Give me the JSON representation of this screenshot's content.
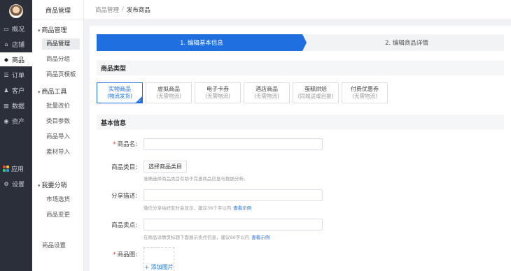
{
  "rail": {
    "items": [
      {
        "label": "概况",
        "icon": "overview-icon",
        "glyph": "▭"
      },
      {
        "label": "店铺",
        "icon": "store-icon",
        "glyph": "⌂"
      },
      {
        "label": "商品",
        "icon": "tag-icon",
        "glyph": "◆"
      },
      {
        "label": "订单",
        "icon": "order-icon",
        "glyph": "☰"
      },
      {
        "label": "客户",
        "icon": "customer-icon",
        "glyph": "♟"
      },
      {
        "label": "数据",
        "icon": "data-icon",
        "glyph": "▥"
      },
      {
        "label": "资产",
        "icon": "asset-icon",
        "glyph": "◉"
      },
      {
        "label": "应用",
        "icon": "apps-icon",
        "glyph": ""
      },
      {
        "label": "设置",
        "icon": "settings-icon",
        "glyph": "⚙"
      }
    ],
    "active_index": 2
  },
  "submenu": {
    "title": "商品管理",
    "groups": [
      {
        "label": "商品管理",
        "items": [
          "商品管理",
          "商品分组",
          "商品页模板"
        ]
      },
      {
        "label": "商品工具",
        "items": [
          "批量改价",
          "类目参数",
          "商品导入",
          "素材导入"
        ]
      },
      {
        "label": "我要分销",
        "items": [
          "市场选货",
          "商品变更"
        ]
      }
    ],
    "footer_item": "商品设置",
    "active_item": "商品管理"
  },
  "breadcrumb": {
    "parent": "商品管理",
    "separator": "/",
    "current": "发布商品"
  },
  "steps": {
    "step1": "1. 编辑基本信息",
    "step2": "2. 编辑商品详情"
  },
  "product_type": {
    "heading": "商品类型",
    "cards": [
      {
        "title": "实物商品",
        "sub": "(物流发货)",
        "selected": true
      },
      {
        "title": "虚拟商品",
        "sub": "(无需物流)",
        "selected": false
      },
      {
        "title": "电子卡券",
        "sub": "(无需物流)",
        "selected": false
      },
      {
        "title": "酒店商品",
        "sub": "(无需物流)",
        "selected": false
      },
      {
        "title": "蛋糕烘焙",
        "sub": "(同城送或自提)",
        "selected": false
      },
      {
        "title": "付费优惠券",
        "sub": "(无需物流)",
        "selected": false
      }
    ]
  },
  "basic_info": {
    "heading": "基本信息",
    "name_label": "商品名:",
    "category_label": "商品类目:",
    "category_button": "选择商品类目",
    "category_help": "准确选择商品类目有助于完善商品信息与数据分析。",
    "share_label": "分享描述:",
    "share_help": "微信分享给好友时会显示，建议36个字以内",
    "share_link": "查看示例",
    "selling_label": "商品卖点:",
    "selling_help": "在商品详情页标题下面展示卖点信息，建议60字以内",
    "selling_link": "查看示例",
    "image_label": "商品图:",
    "image_button": "+ 添加图片"
  },
  "colors": {
    "accent": "#1f6fe0",
    "rail_bg": "#2b2f3a",
    "required": "#e53935"
  }
}
